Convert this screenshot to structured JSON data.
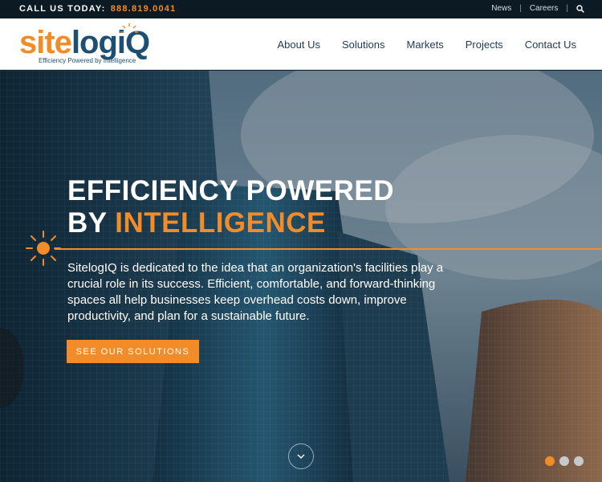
{
  "topbar": {
    "call_label": "CALL US TODAY:",
    "phone": "888.819.0041",
    "links": [
      "News",
      "Careers"
    ],
    "search_icon": "search-icon"
  },
  "logo": {
    "wordmark_part1": "site",
    "wordmark_part2": "logiQ",
    "tagline": "Efficiency Powered by Intelligence"
  },
  "nav": {
    "items": [
      "About Us",
      "Solutions",
      "Markets",
      "Projects",
      "Contact Us"
    ]
  },
  "hero": {
    "headline_line1": "EFFICIENCY POWERED",
    "headline_line2_prefix": "BY ",
    "headline_line2_accent": "INTELLIGENCE",
    "body": "SitelogIQ is dedicated to the idea that an organization's facilities play a crucial role in its success. Efficient, comfortable, and forward-thinking spaces all help businesses keep overhead costs down, improve productivity, and plan for a sustainable future.",
    "cta_label": "SEE OUR SOLUTIONS",
    "slides": 3,
    "active_slide": 1
  },
  "colors": {
    "accent": "#f28c28",
    "brand_blue": "#1d4f73",
    "topbar_bg": "#0c1a24"
  }
}
